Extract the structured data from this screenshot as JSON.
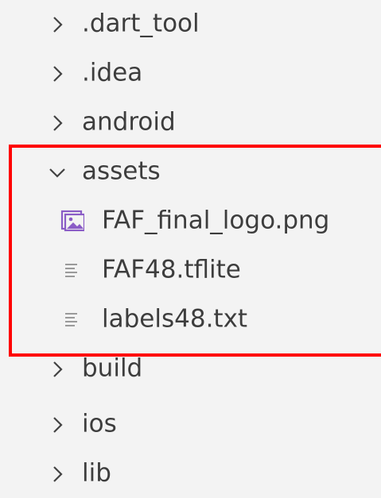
{
  "explorer": {
    "items": [
      {
        "label": ".dart_tool",
        "kind": "folder",
        "state": "collapsed",
        "icon": "chevron-right-icon"
      },
      {
        "label": ".idea",
        "kind": "folder",
        "state": "collapsed",
        "icon": "chevron-right-icon"
      },
      {
        "label": "android",
        "kind": "folder",
        "state": "collapsed",
        "icon": "chevron-right-icon"
      },
      {
        "label": "assets",
        "kind": "folder",
        "state": "expanded",
        "icon": "chevron-down-icon"
      },
      {
        "label": "FAF_final_logo.png",
        "kind": "file",
        "icon": "image-file-icon"
      },
      {
        "label": "FAF48.tflite",
        "kind": "file",
        "icon": "text-file-icon"
      },
      {
        "label": "labels48.txt",
        "kind": "file",
        "icon": "text-file-icon"
      },
      {
        "label": "build",
        "kind": "folder",
        "state": "collapsed",
        "icon": "chevron-right-icon"
      },
      {
        "label": "ios",
        "kind": "folder",
        "state": "collapsed",
        "icon": "chevron-right-icon"
      },
      {
        "label": "lib",
        "kind": "folder",
        "state": "collapsed",
        "icon": "chevron-right-icon"
      }
    ]
  },
  "colors": {
    "background": "#f3f3f3",
    "text": "#3d3d3d",
    "highlight_border": "#ff0000",
    "image_icon": "#8a5cc6",
    "text_file_icon": "#9a9a9a"
  }
}
